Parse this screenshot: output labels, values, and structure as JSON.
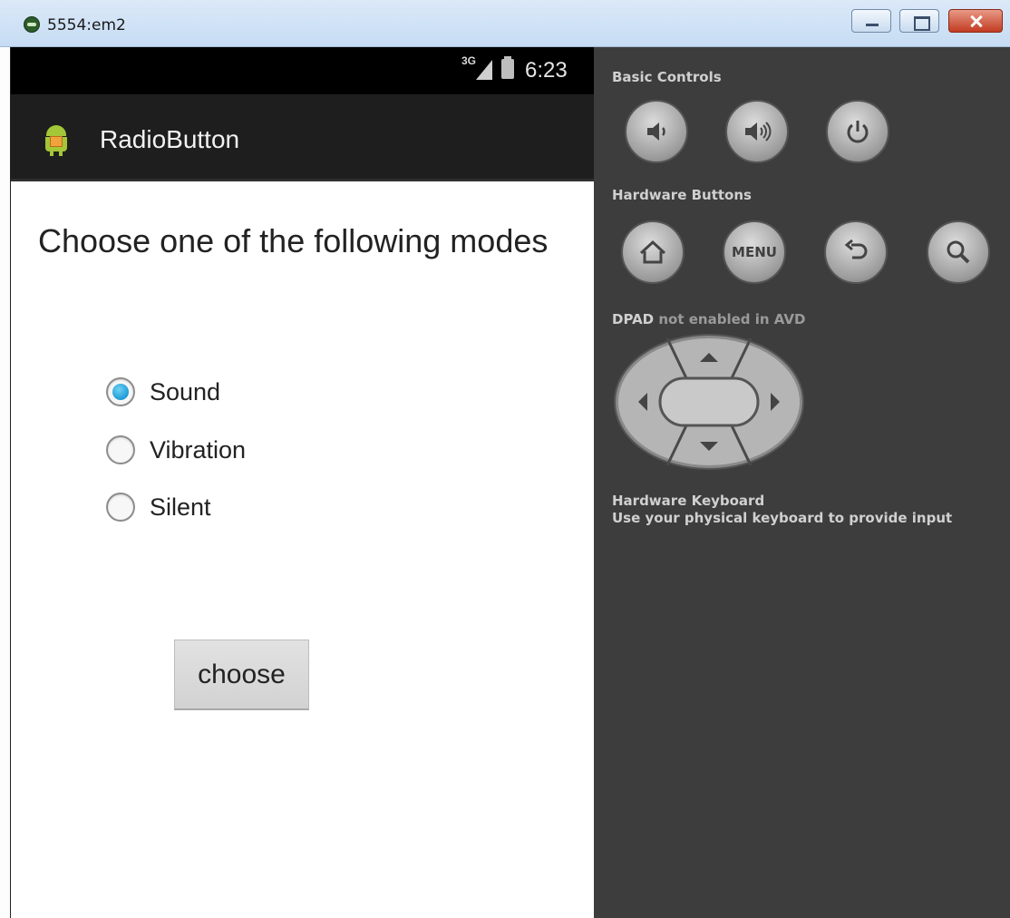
{
  "window": {
    "title": "5554:em2"
  },
  "statusbar": {
    "network": "3G",
    "time": "6:23"
  },
  "actionbar": {
    "title": "RadioButton"
  },
  "main": {
    "heading": "Choose one of the following modes",
    "radios": [
      {
        "label": "Sound",
        "checked": true
      },
      {
        "label": "Vibration",
        "checked": false
      },
      {
        "label": "Silent",
        "checked": false
      }
    ],
    "button_label": "choose"
  },
  "controls": {
    "basic_controls_label": "Basic Controls",
    "hardware_buttons_label": "Hardware Buttons",
    "dpad_label": "DPAD",
    "dpad_status": "not enabled in AVD",
    "menu_label": "MENU",
    "keyboard_title": "Hardware Keyboard",
    "keyboard_desc": "Use your physical keyboard to provide input"
  },
  "colors": {
    "radio_checked": "#1e9bd5",
    "panel_bg": "#3d3d3d"
  }
}
